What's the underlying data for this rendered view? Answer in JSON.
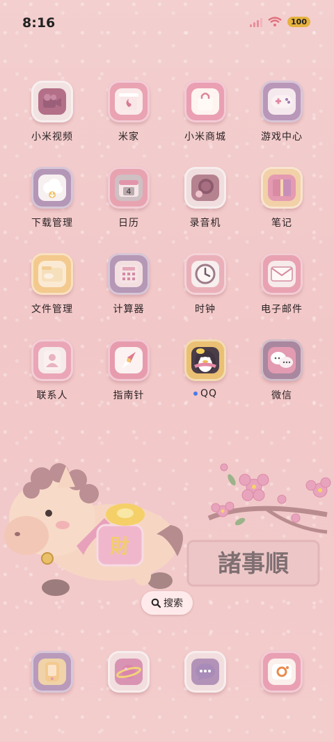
{
  "status": {
    "time": "8:16",
    "battery": "100"
  },
  "apps": [
    [
      {
        "label": "小米视频",
        "icon": "video-camera-icon",
        "bg": "#f2e2e2",
        "inner": "#b46f88"
      },
      {
        "label": "米家",
        "icon": "home-fireplace-icon",
        "bg": "#e9a3b2",
        "inner": "#fbeaea"
      },
      {
        "label": "小米商城",
        "icon": "shopping-bag-icon",
        "bg": "#ea9fb3",
        "inner": "#fff4f0"
      },
      {
        "label": "游戏中心",
        "icon": "gamepad-icon",
        "bg": "#b997b9",
        "inner": "#f6e9ee"
      }
    ],
    [
      {
        "label": "下载管理",
        "icon": "cloud-download-icon",
        "bg": "#b497b7",
        "inner": "#f7f0f1"
      },
      {
        "label": "日历",
        "icon": "calendar-icon",
        "bg": "#e8a3b1",
        "inner": "#cfc0c4"
      },
      {
        "label": "录音机",
        "icon": "magnifier-recorder-icon",
        "bg": "#f0dede",
        "inner": "#b58290"
      },
      {
        "label": "笔记",
        "icon": "notebook-icon",
        "bg": "#f2d0a8",
        "inner": "#e49ab1"
      }
    ],
    [
      {
        "label": "文件管理",
        "icon": "folder-icon",
        "bg": "#f3c98e",
        "inner": "#fbead3"
      },
      {
        "label": "计算器",
        "icon": "calculator-icon",
        "bg": "#b597b6",
        "inner": "#f3dfe0"
      },
      {
        "label": "时钟",
        "icon": "clock-icon",
        "bg": "#eab0b9",
        "inner": "#f7eeee"
      },
      {
        "label": "电子邮件",
        "icon": "envelope-icon",
        "bg": "#e8a2b1",
        "inner": "#f7eaea"
      }
    ],
    [
      {
        "label": "联系人",
        "icon": "contact-person-icon",
        "bg": "#eaa6b6",
        "inner": "#f6ebeb"
      },
      {
        "label": "指南针",
        "icon": "compass-icon",
        "bg": "#e79cae",
        "inner": "#fbf2f1"
      },
      {
        "label": "QQ",
        "icon": "penguin-icon",
        "bg": "#eac074",
        "inner": "#4a3d48",
        "dot": true
      },
      {
        "label": "微信",
        "icon": "chat-bubbles-icon",
        "bg": "#a9879f",
        "inner": "#e39bb2"
      }
    ]
  ],
  "search": {
    "label": "搜索"
  },
  "wallpaper": {
    "banner": "諸事順",
    "saddle": "財"
  },
  "dock": [
    {
      "icon": "phone-icon",
      "bg": "#b99abb",
      "inner": "#f0d3a8"
    },
    {
      "icon": "planet-browser-icon",
      "bg": "#f2dede",
      "inner": "#d994b3"
    },
    {
      "icon": "message-bubble-icon",
      "bg": "#f2dede",
      "inner": "#b392b8"
    },
    {
      "icon": "camera-icon",
      "bg": "#e9a0b3",
      "inner": "#fbf0ec"
    }
  ]
}
